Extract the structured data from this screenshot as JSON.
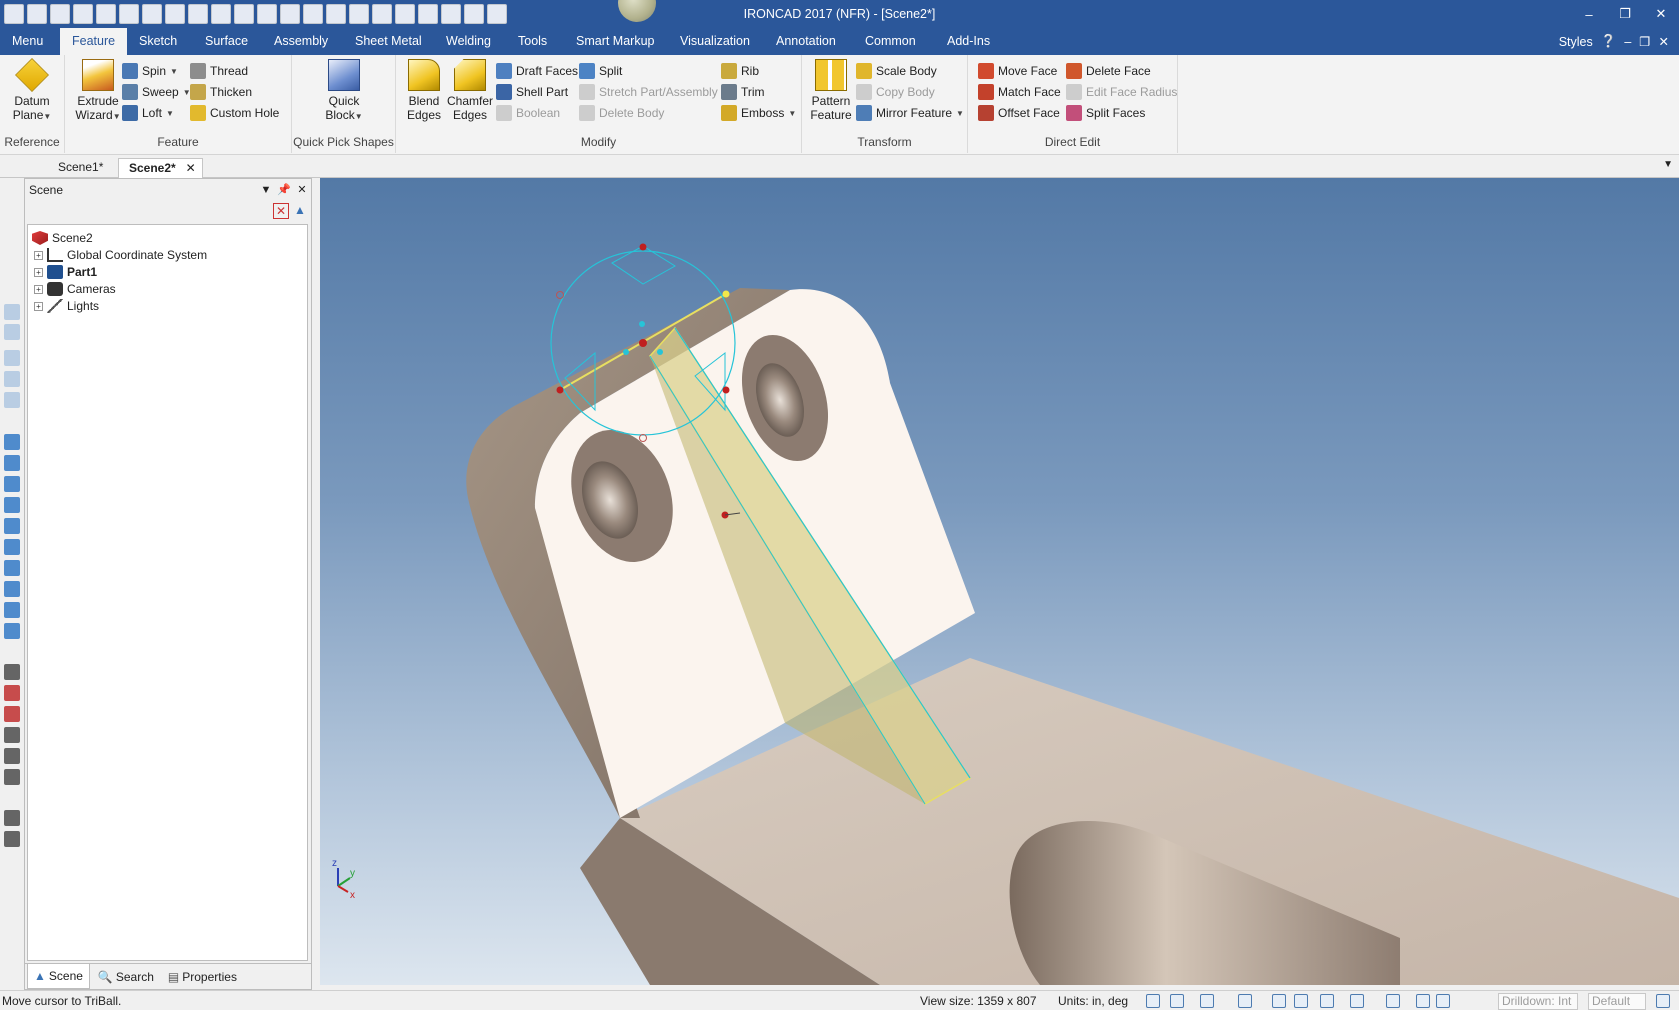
{
  "window": {
    "title": "IRONCAD 2017 (NFR) - [Scene2*]"
  },
  "ribbon_tabs": [
    "Menu",
    "Feature",
    "Sketch",
    "Surface",
    "Assembly",
    "Sheet Metal",
    "Welding",
    "Tools",
    "Smart Markup",
    "Visualization",
    "Annotation",
    "Common",
    "Add-Ins"
  ],
  "active_tab": "Feature",
  "styles_label": "Styles",
  "groups": {
    "reference": {
      "label": "Reference",
      "datum_plane": "Datum\nPlane"
    },
    "feature": {
      "label": "Feature",
      "extrude_wizard": "Extrude\nWizard",
      "spin": "Spin",
      "sweep": "Sweep",
      "loft": "Loft",
      "thread": "Thread",
      "thicken": "Thicken",
      "custom_hole": "Custom Hole"
    },
    "quick_pick": {
      "label": "Quick Pick Shapes",
      "quick_block": "Quick\nBlock"
    },
    "modify": {
      "label": "Modify",
      "blend_edges": "Blend\nEdges",
      "chamfer_edges": "Chamfer\nEdges",
      "draft_faces": "Draft Faces",
      "shell_part": "Shell Part",
      "boolean": "Boolean",
      "split": "Split",
      "stretch": "Stretch Part/Assembly",
      "delete_body": "Delete Body",
      "rib": "Rib",
      "trim": "Trim",
      "emboss": "Emboss"
    },
    "transform": {
      "label": "Transform",
      "pattern_feature": "Pattern\nFeature",
      "scale_body": "Scale Body",
      "copy_body": "Copy Body",
      "mirror_feature": "Mirror Feature"
    },
    "direct_edit": {
      "label": "Direct Edit",
      "move_face": "Move Face",
      "match_face": "Match Face",
      "offset_face": "Offset Face",
      "delete_face": "Delete Face",
      "edit_face_radius": "Edit Face Radius",
      "split_faces": "Split Faces"
    }
  },
  "doc_tabs": [
    "Scene1*",
    "Scene2*"
  ],
  "active_doc": "Scene2*",
  "scene_panel": {
    "title": "Scene",
    "tree": [
      {
        "label": "Scene2",
        "bold": false
      },
      {
        "label": "Global Coordinate System",
        "bold": false
      },
      {
        "label": "Part1",
        "bold": true
      },
      {
        "label": "Cameras",
        "bold": false
      },
      {
        "label": "Lights",
        "bold": false
      }
    ],
    "bottom_tabs": [
      "Scene",
      "Search",
      "Properties"
    ]
  },
  "axis_labels": {
    "z": "z",
    "y": "y",
    "x": "x"
  },
  "status": {
    "message": "Move cursor to TriBall.",
    "view_size": "View size: 1359 x  807",
    "units": "Units: in, deg",
    "drilldown": "Drilldown: Int",
    "default": "Default"
  },
  "colors": {
    "accent": "#2b579a",
    "part_face": "#fbf4ee",
    "part_side": "#8f8178",
    "rib_highlight": "#d9d08a",
    "triball": "#26c4d8"
  }
}
